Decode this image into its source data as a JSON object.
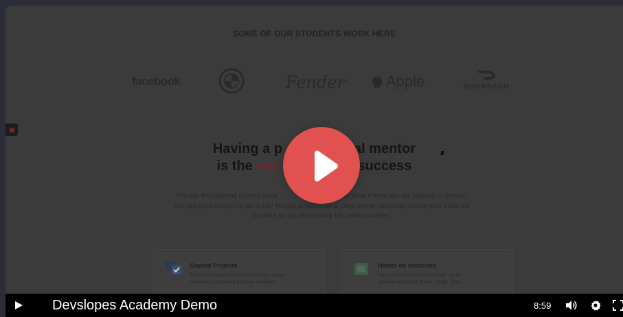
{
  "video": {
    "students_heading": "SOME OF OUR STUDENTS WORK HERE",
    "logos": {
      "facebook": "facebook",
      "fender": "Fender",
      "apple": "Apple",
      "doordash": "DOORDASH"
    },
    "mentor_title": {
      "line1_a": "Having a p",
      "line1_b": "al mentor",
      "line2_a": "is the ",
      "line2_accent": "sec",
      "line2_b": "o success"
    },
    "intro_paragraph": "You can find learning content anyw                                  you know if what you are building is correct? Are you good enough to get a job? Having a professional programmer personally review your code will do more for you than taking 100 online courses!",
    "cards": [
      {
        "title": "Graded Projects",
        "text": "The fastest way to learn is by having experts review your code and give you feedback."
      },
      {
        "title": "Hands-on exercises",
        "text": "You won't just learn how to code, you'll actually write code. Every. Single. Day."
      }
    ]
  },
  "player": {
    "video_title": "Devslopes Academy Demo",
    "time": "8:59",
    "accent_color": "#e0514f",
    "icons": [
      "play-icon",
      "volume-icon",
      "settings-icon",
      "fullscreen-icon"
    ]
  }
}
